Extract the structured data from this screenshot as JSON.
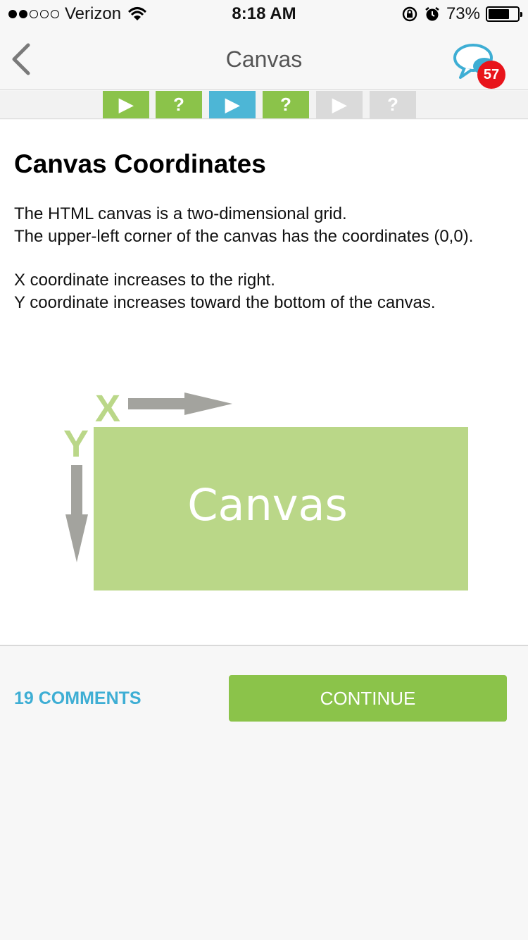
{
  "status_bar": {
    "carrier": "Verizon",
    "signal_bars": 2,
    "time": "8:18 AM",
    "battery_percent": "73%",
    "battery_level": 0.73
  },
  "nav": {
    "title": "Canvas",
    "badge_count": "57",
    "back_icon": "chevron-left-icon",
    "chat_icon": "chat-bubbles-icon"
  },
  "progress_steps": [
    {
      "glyph": "▶",
      "state": "done"
    },
    {
      "glyph": "?",
      "state": "done"
    },
    {
      "glyph": "▶",
      "state": "current"
    },
    {
      "glyph": "?",
      "state": "done"
    },
    {
      "glyph": "▶",
      "state": "locked"
    },
    {
      "glyph": "?",
      "state": "locked"
    }
  ],
  "lesson": {
    "title": "Canvas Coordinates",
    "paragraph1_line1": "The HTML canvas is a two-dimensional grid.",
    "paragraph1_line2": "The upper-left corner of the canvas has the coordinates (0,0).",
    "paragraph2_line1": "X coordinate increases to the right.",
    "paragraph2_line2": "Y coordinate increases toward the bottom of the canvas.",
    "diagram": {
      "x_label": "X",
      "y_label": "Y",
      "canvas_label": "Canvas"
    }
  },
  "footer": {
    "comments_label": "19 COMMENTS",
    "continue_label": "CONTINUE"
  },
  "colors": {
    "green": "#8bc34a",
    "blue": "#4db6d6",
    "light_green": "#bad788",
    "gray_arrow": "#a3a39e",
    "locked": "#dadada",
    "badge": "#e8141b",
    "link": "#3eaed4"
  }
}
